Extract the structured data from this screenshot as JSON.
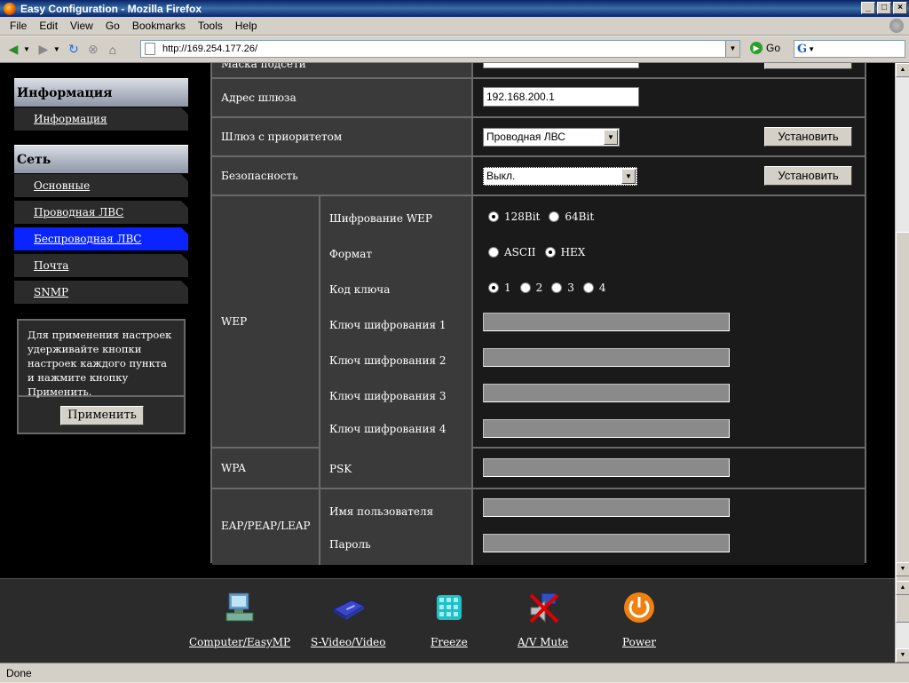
{
  "window": {
    "title": "Easy Configuration - Mozilla Firefox",
    "buttons": [
      "_",
      "□",
      "×"
    ]
  },
  "menubar": {
    "items": [
      "File",
      "Edit",
      "View",
      "Go",
      "Bookmarks",
      "Tools",
      "Help"
    ]
  },
  "navbar": {
    "url": "http://169.254.177.26/",
    "go_label": "Go",
    "search_icon": "G"
  },
  "sidebar": {
    "sections": [
      {
        "title": "Информация",
        "items": [
          "Информация"
        ]
      },
      {
        "title": "Сеть",
        "items": [
          "Основные",
          "Проводная ЛВС",
          "Беспроводная ЛВС",
          "Почта",
          "SNMP"
        ]
      }
    ],
    "active_item": "Беспроводная ЛВС",
    "note": "Для применения настроек удерживайте кнопки настроек каждого пункта и нажмите кнопку Применить.",
    "apply_label": "Применить"
  },
  "form": {
    "subnet_label": "Маска подсети",
    "gateway_label": "Адрес шлюза",
    "gateway_value": "192.168.200.1",
    "priority_gw_label": "Шлюз с приоритетом",
    "priority_gw_value": "Проводная ЛВС",
    "security_label": "Безопасность",
    "security_value": "Выкл.",
    "set_label": "Установить",
    "wep": {
      "group_label": "WEP",
      "encryption_label": "Шифрование WEP",
      "encryption_options": [
        "128Bit",
        "64Bit"
      ],
      "encryption_selected": 0,
      "format_label": "Формат",
      "format_options": [
        "ASCII",
        "HEX"
      ],
      "format_selected": 1,
      "key_code_label": "Код ключа",
      "key_code_options": [
        "1",
        "2",
        "3",
        "4"
      ],
      "key_code_selected": 0,
      "keys": [
        "Ключ шифрования 1",
        "Ключ шифрования 2",
        "Ключ шифрования 3",
        "Ключ шифрования 4"
      ]
    },
    "wpa": {
      "group_label": "WPA",
      "psk_label": "PSK"
    },
    "eap": {
      "group_label": "EAP/PEAP/LEAP",
      "user_label": "Имя пользователя",
      "password_label": "Пароль"
    }
  },
  "bottombar": {
    "items": [
      {
        "label": "Computer/EasyMP",
        "icon": "computer-icon"
      },
      {
        "label": "S-Video/Video",
        "icon": "vcr-icon"
      },
      {
        "label": "Freeze",
        "icon": "freeze-icon"
      },
      {
        "label": "A/V Mute",
        "icon": "av-mute-icon"
      },
      {
        "label": "Power",
        "icon": "power-icon"
      }
    ]
  },
  "statusbar": {
    "text": "Done"
  }
}
